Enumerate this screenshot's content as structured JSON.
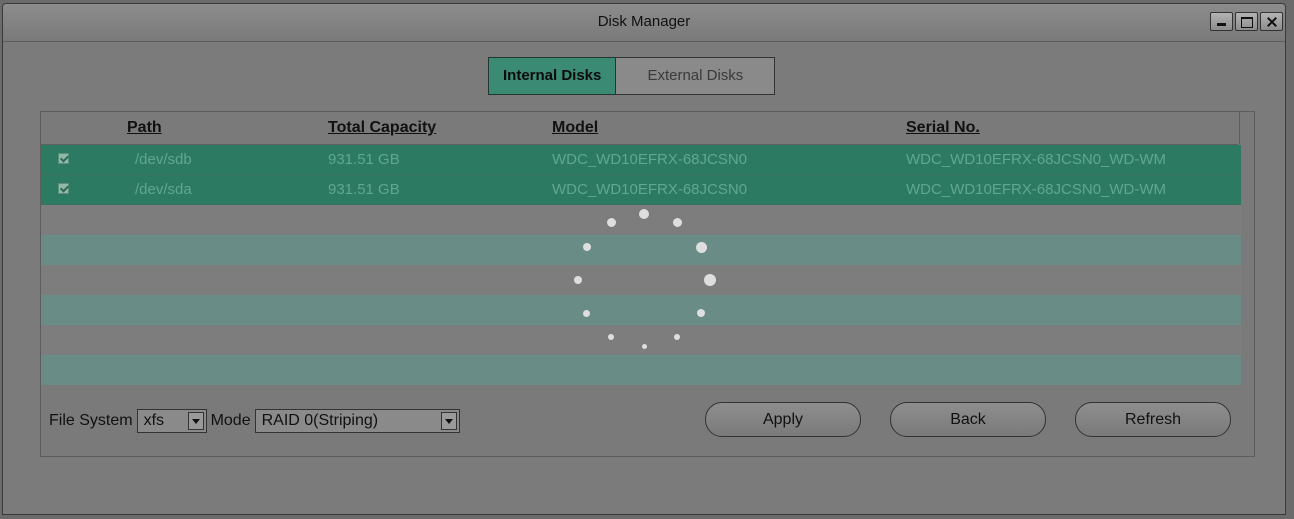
{
  "window": {
    "title": "Disk Manager"
  },
  "tabs": [
    {
      "label": "Internal Disks",
      "active": true
    },
    {
      "label": "External Disks",
      "active": false
    }
  ],
  "table": {
    "headers": [
      "Path",
      "Total Capacity",
      "Model",
      "Serial No."
    ],
    "rows": [
      {
        "checked": true,
        "path": "/dev/sdb",
        "capacity": "931.51 GB",
        "model": "WDC_WD10EFRX-68JCSN0",
        "serial": "WDC_WD10EFRX-68JCSN0_WD-WM"
      },
      {
        "checked": true,
        "path": "/dev/sda",
        "capacity": "931.51 GB",
        "model": "WDC_WD10EFRX-68JCSN0",
        "serial": "WDC_WD10EFRX-68JCSN0_WD-WM"
      }
    ]
  },
  "controls": {
    "file_system_label": "File System",
    "file_system_value": "xfs",
    "mode_label": "Mode",
    "mode_value": "RAID 0(Striping)",
    "apply_label": "Apply",
    "back_label": "Back",
    "refresh_label": "Refresh"
  },
  "colors": {
    "accent": "#3b8a74",
    "selected_row": "#2d7a63"
  },
  "icons": {
    "loading": "loading-spinner-icon",
    "checkbox": "checkbox-checked-icon",
    "dropdown": "chevron-down-icon"
  }
}
